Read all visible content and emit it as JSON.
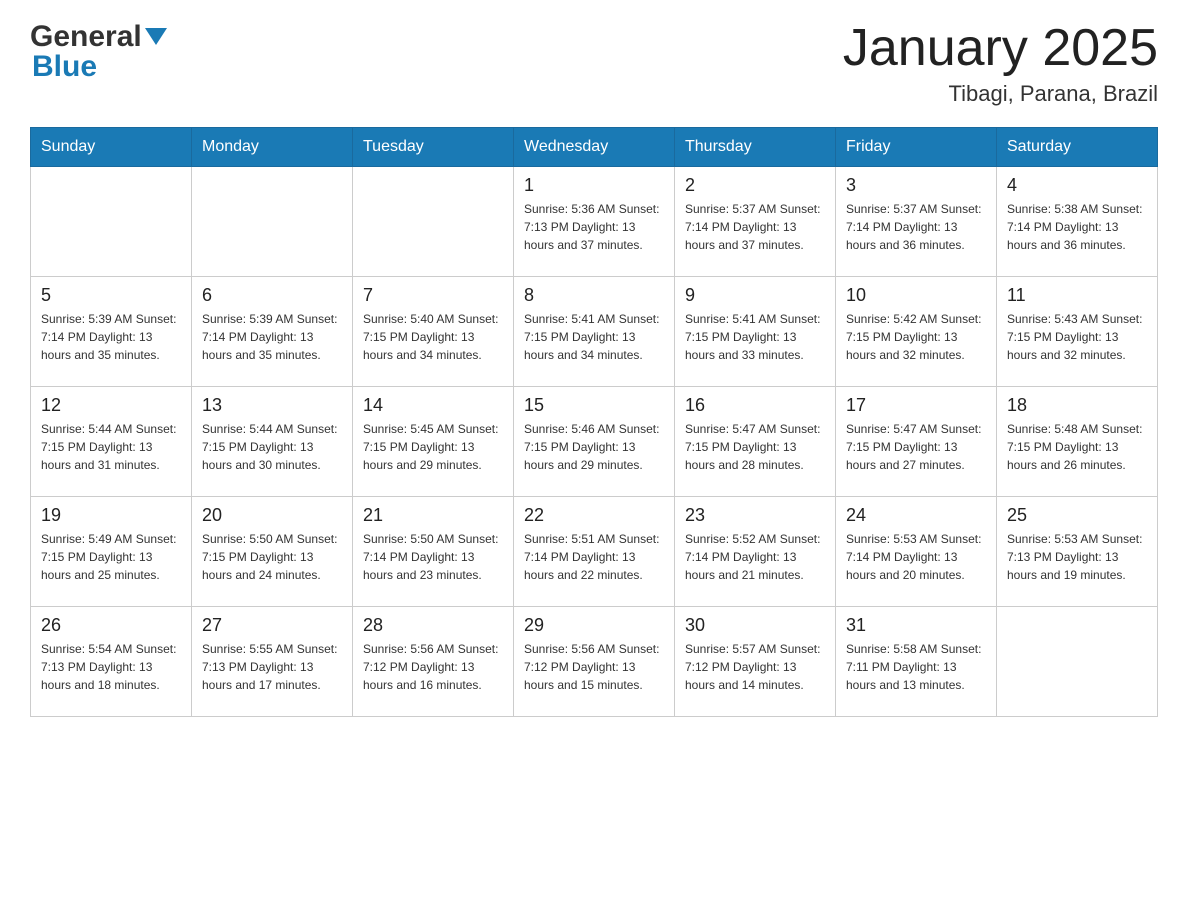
{
  "header": {
    "logo_text_general": "General",
    "logo_text_blue": "Blue",
    "main_title": "January 2025",
    "subtitle": "Tibagi, Parana, Brazil"
  },
  "calendar": {
    "days_of_week": [
      "Sunday",
      "Monday",
      "Tuesday",
      "Wednesday",
      "Thursday",
      "Friday",
      "Saturday"
    ],
    "weeks": [
      [
        {
          "day": "",
          "info": ""
        },
        {
          "day": "",
          "info": ""
        },
        {
          "day": "",
          "info": ""
        },
        {
          "day": "1",
          "info": "Sunrise: 5:36 AM\nSunset: 7:13 PM\nDaylight: 13 hours\nand 37 minutes."
        },
        {
          "day": "2",
          "info": "Sunrise: 5:37 AM\nSunset: 7:14 PM\nDaylight: 13 hours\nand 37 minutes."
        },
        {
          "day": "3",
          "info": "Sunrise: 5:37 AM\nSunset: 7:14 PM\nDaylight: 13 hours\nand 36 minutes."
        },
        {
          "day": "4",
          "info": "Sunrise: 5:38 AM\nSunset: 7:14 PM\nDaylight: 13 hours\nand 36 minutes."
        }
      ],
      [
        {
          "day": "5",
          "info": "Sunrise: 5:39 AM\nSunset: 7:14 PM\nDaylight: 13 hours\nand 35 minutes."
        },
        {
          "day": "6",
          "info": "Sunrise: 5:39 AM\nSunset: 7:14 PM\nDaylight: 13 hours\nand 35 minutes."
        },
        {
          "day": "7",
          "info": "Sunrise: 5:40 AM\nSunset: 7:15 PM\nDaylight: 13 hours\nand 34 minutes."
        },
        {
          "day": "8",
          "info": "Sunrise: 5:41 AM\nSunset: 7:15 PM\nDaylight: 13 hours\nand 34 minutes."
        },
        {
          "day": "9",
          "info": "Sunrise: 5:41 AM\nSunset: 7:15 PM\nDaylight: 13 hours\nand 33 minutes."
        },
        {
          "day": "10",
          "info": "Sunrise: 5:42 AM\nSunset: 7:15 PM\nDaylight: 13 hours\nand 32 minutes."
        },
        {
          "day": "11",
          "info": "Sunrise: 5:43 AM\nSunset: 7:15 PM\nDaylight: 13 hours\nand 32 minutes."
        }
      ],
      [
        {
          "day": "12",
          "info": "Sunrise: 5:44 AM\nSunset: 7:15 PM\nDaylight: 13 hours\nand 31 minutes."
        },
        {
          "day": "13",
          "info": "Sunrise: 5:44 AM\nSunset: 7:15 PM\nDaylight: 13 hours\nand 30 minutes."
        },
        {
          "day": "14",
          "info": "Sunrise: 5:45 AM\nSunset: 7:15 PM\nDaylight: 13 hours\nand 29 minutes."
        },
        {
          "day": "15",
          "info": "Sunrise: 5:46 AM\nSunset: 7:15 PM\nDaylight: 13 hours\nand 29 minutes."
        },
        {
          "day": "16",
          "info": "Sunrise: 5:47 AM\nSunset: 7:15 PM\nDaylight: 13 hours\nand 28 minutes."
        },
        {
          "day": "17",
          "info": "Sunrise: 5:47 AM\nSunset: 7:15 PM\nDaylight: 13 hours\nand 27 minutes."
        },
        {
          "day": "18",
          "info": "Sunrise: 5:48 AM\nSunset: 7:15 PM\nDaylight: 13 hours\nand 26 minutes."
        }
      ],
      [
        {
          "day": "19",
          "info": "Sunrise: 5:49 AM\nSunset: 7:15 PM\nDaylight: 13 hours\nand 25 minutes."
        },
        {
          "day": "20",
          "info": "Sunrise: 5:50 AM\nSunset: 7:15 PM\nDaylight: 13 hours\nand 24 minutes."
        },
        {
          "day": "21",
          "info": "Sunrise: 5:50 AM\nSunset: 7:14 PM\nDaylight: 13 hours\nand 23 minutes."
        },
        {
          "day": "22",
          "info": "Sunrise: 5:51 AM\nSunset: 7:14 PM\nDaylight: 13 hours\nand 22 minutes."
        },
        {
          "day": "23",
          "info": "Sunrise: 5:52 AM\nSunset: 7:14 PM\nDaylight: 13 hours\nand 21 minutes."
        },
        {
          "day": "24",
          "info": "Sunrise: 5:53 AM\nSunset: 7:14 PM\nDaylight: 13 hours\nand 20 minutes."
        },
        {
          "day": "25",
          "info": "Sunrise: 5:53 AM\nSunset: 7:13 PM\nDaylight: 13 hours\nand 19 minutes."
        }
      ],
      [
        {
          "day": "26",
          "info": "Sunrise: 5:54 AM\nSunset: 7:13 PM\nDaylight: 13 hours\nand 18 minutes."
        },
        {
          "day": "27",
          "info": "Sunrise: 5:55 AM\nSunset: 7:13 PM\nDaylight: 13 hours\nand 17 minutes."
        },
        {
          "day": "28",
          "info": "Sunrise: 5:56 AM\nSunset: 7:12 PM\nDaylight: 13 hours\nand 16 minutes."
        },
        {
          "day": "29",
          "info": "Sunrise: 5:56 AM\nSunset: 7:12 PM\nDaylight: 13 hours\nand 15 minutes."
        },
        {
          "day": "30",
          "info": "Sunrise: 5:57 AM\nSunset: 7:12 PM\nDaylight: 13 hours\nand 14 minutes."
        },
        {
          "day": "31",
          "info": "Sunrise: 5:58 AM\nSunset: 7:11 PM\nDaylight: 13 hours\nand 13 minutes."
        },
        {
          "day": "",
          "info": ""
        }
      ]
    ]
  }
}
